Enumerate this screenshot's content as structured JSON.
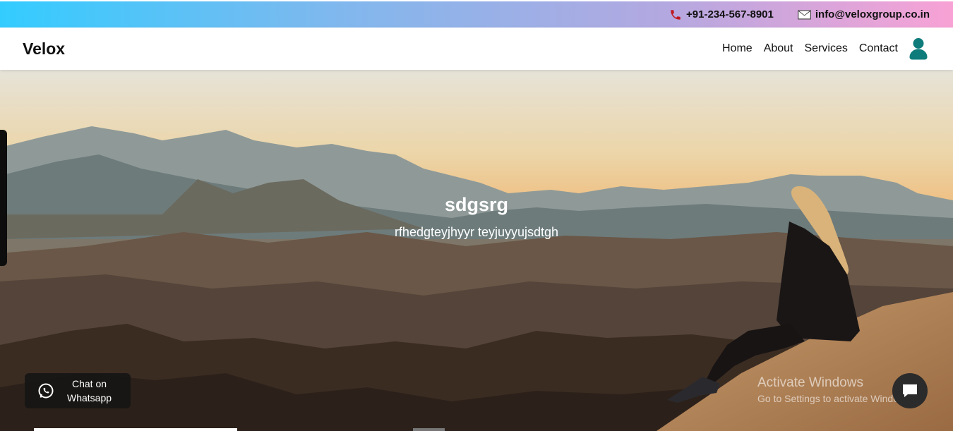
{
  "topbar": {
    "phone": "+91-234-567-8901",
    "email": "info@veloxgroup.co.in",
    "phone_icon": "phone-icon",
    "email_icon": "mail-icon"
  },
  "header": {
    "logo": "Velox",
    "nav": [
      "Home",
      "About",
      "Services",
      "Contact"
    ],
    "user_icon": "user-icon",
    "accent": "#0e7c7b"
  },
  "hero": {
    "title": "sdgsrg",
    "subtitle": "rfhedgteyjhyyr teyjuyyujsdtgh"
  },
  "whatsapp": {
    "line1": "Chat on",
    "line2": "Whatsapp",
    "icon": "whatsapp-icon"
  },
  "watermark": {
    "title": "Activate Windows",
    "subtitle": "Go to Settings to activate Windows."
  },
  "chat": {
    "icon": "chat-bubble-icon"
  }
}
